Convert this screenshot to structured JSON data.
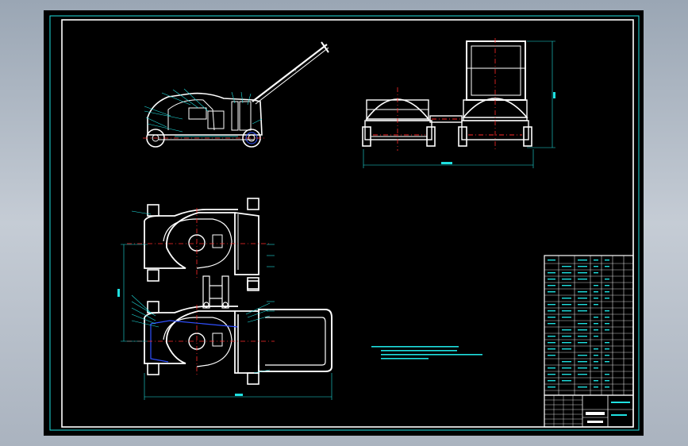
{
  "drawing": {
    "background": "#000000",
    "frame_color": "#1fe0e0",
    "part_color": "#ffffff",
    "centerline_color": "#ff2a2a",
    "hidden_line_color": "#3050ff"
  },
  "views": {
    "side_view": "mower-side-view",
    "front_view": "mower-front-view",
    "top_view": "mower-top-view"
  },
  "title_block": {
    "visible": true
  }
}
